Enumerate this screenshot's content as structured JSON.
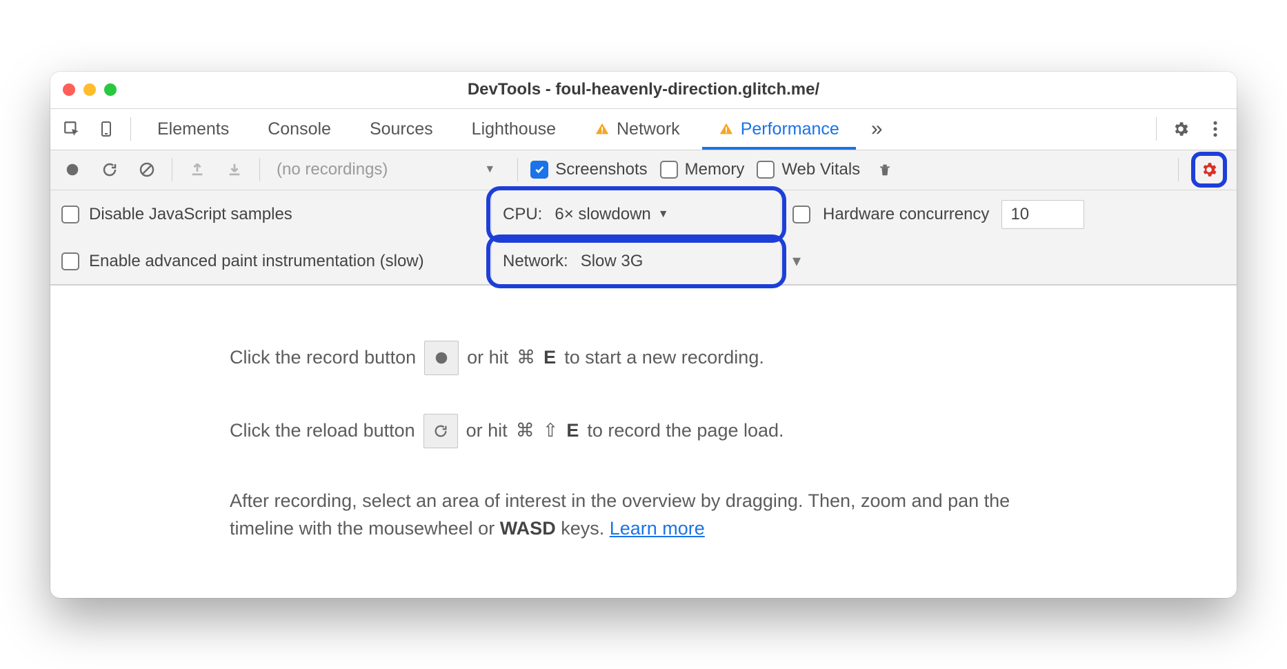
{
  "window": {
    "title": "DevTools - foul-heavenly-direction.glitch.me/"
  },
  "tabs": {
    "items": [
      "Elements",
      "Console",
      "Sources",
      "Lighthouse",
      "Network",
      "Performance"
    ],
    "active": "Performance"
  },
  "toolbar": {
    "recordings": "(no recordings)",
    "screenshots": "Screenshots",
    "memory": "Memory",
    "webvitals": "Web Vitals"
  },
  "settings": {
    "disableJs": "Disable JavaScript samples",
    "paint": "Enable advanced paint instrumentation (slow)",
    "cpuLabel": "CPU:",
    "cpuValue": "6× slowdown",
    "netLabel": "Network:",
    "netValue": "Slow 3G",
    "hwLabel": "Hardware concurrency",
    "hwValue": "10"
  },
  "hints": {
    "rec1a": "Click the record button",
    "rec1b": "or hit",
    "rec1cmd": "⌘",
    "rec1key": "E",
    "rec1c": "to start a new recording.",
    "rel1a": "Click the reload button",
    "rel1b": "or hit",
    "rel1cmd": "⌘",
    "rel1shift": "⇧",
    "rel1key": "E",
    "rel1c": "to record the page load.",
    "after1": "After recording, select an area of interest in the overview by dragging. Then, zoom and pan the timeline with the mousewheel or ",
    "wasd": "WASD",
    "after2": " keys. ",
    "learn": "Learn more"
  }
}
